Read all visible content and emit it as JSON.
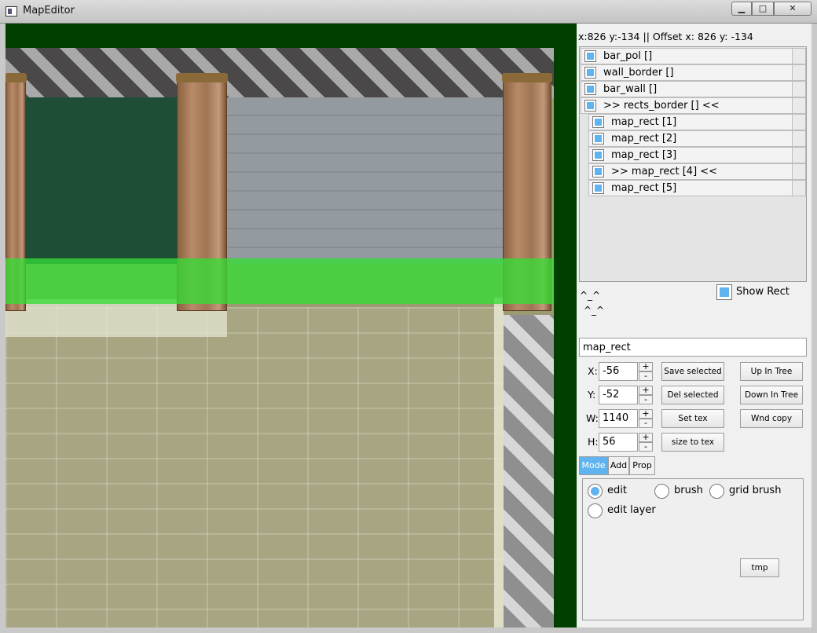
{
  "window": {
    "title": "MapEditor",
    "minimize": "▁",
    "maximize": "□",
    "close": "✕"
  },
  "status": {
    "coords": "x:826 y:-134 || Offset x: 826 y: -134"
  },
  "tree": {
    "items": [
      {
        "label": "bar_pol []"
      },
      {
        "label": "wall_border []"
      },
      {
        "label": "bar_wall []"
      },
      {
        "label": ">> rects_border [] <<"
      },
      {
        "label": "map_rect [1]"
      },
      {
        "label": "map_rect [2]"
      },
      {
        "label": "map_rect [3]"
      },
      {
        "label": ">> map_rect [4] <<"
      },
      {
        "label": "map_rect [5]"
      }
    ]
  },
  "faces": {
    "line1": "^_^",
    "line2": "^_^"
  },
  "show_rect": {
    "label": "Show Rect"
  },
  "selected_name": "map_rect",
  "props": {
    "x_label": "X:",
    "x_value": "-56",
    "y_label": "Y:",
    "y_value": "-52",
    "w_label": "W:",
    "w_value": "1140",
    "h_label": "H:",
    "h_value": "56",
    "plus": "+",
    "minus": "-"
  },
  "buttons": {
    "save_selected": "Save selected",
    "up_in_tree": "Up In Tree",
    "del_selected": "Del selected",
    "down_in_tree": "Down In Tree",
    "set_tex": "Set tex",
    "wnd_copy": "Wnd copy",
    "size_to_tex": "size to tex",
    "tmp": "tmp"
  },
  "tabs": {
    "mode": "Mode",
    "add": "Add",
    "prop": "Prop",
    "active": "Mode"
  },
  "mode": {
    "edit": "edit",
    "brush": "brush",
    "grid_brush": "grid brush",
    "edit_layer": "edit layer",
    "selected": "edit"
  },
  "colors": {
    "accent": "#5fb4ef",
    "map_bg": "#003f00"
  }
}
